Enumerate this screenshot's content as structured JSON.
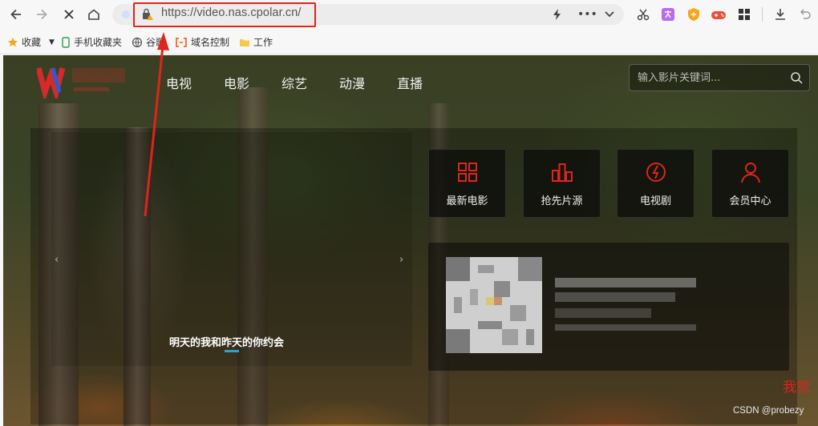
{
  "browser": {
    "url": "https://video.nas.cpolar.cn/",
    "bookmarks": [
      {
        "label": "收藏"
      },
      {
        "label": "手机收藏夹"
      },
      {
        "label": "谷歌"
      },
      {
        "label": "域名控制"
      },
      {
        "label": "工作"
      }
    ],
    "colors": {
      "highlight": "#e0241a"
    }
  },
  "site": {
    "nav": [
      "电视",
      "电影",
      "综艺",
      "动漫",
      "直播"
    ],
    "search_placeholder": "输入影片关键词...",
    "slide_caption": "明天的我和昨天的你约会",
    "cards": [
      {
        "label": "最新电影",
        "icon": "grid-icon"
      },
      {
        "label": "抢先片源",
        "icon": "bars-icon"
      },
      {
        "label": "电视剧",
        "icon": "tv-icon"
      },
      {
        "label": "会员中心",
        "icon": "user-icon"
      }
    ],
    "side_text": "我觉",
    "watermark": "CSDN @probezy",
    "accent": "#e0241a"
  }
}
